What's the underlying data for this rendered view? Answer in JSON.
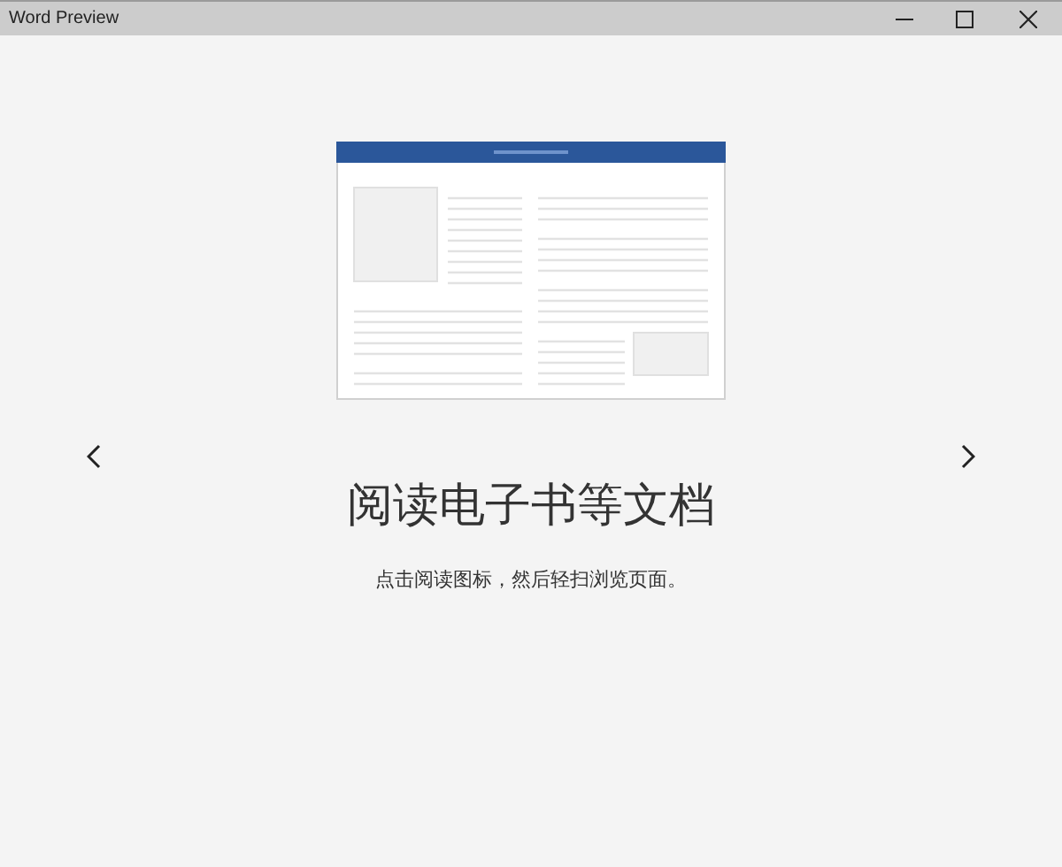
{
  "window": {
    "title": "Word Preview"
  },
  "slide": {
    "heading": "阅读电子书等文档",
    "description": "点击阅读图标，然后轻扫浏览页面。"
  }
}
